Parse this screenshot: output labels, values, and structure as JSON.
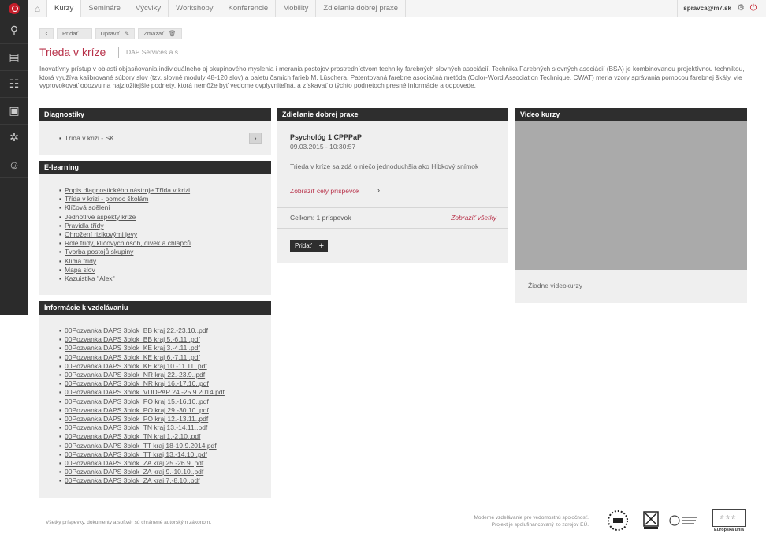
{
  "topbar": {
    "tabs": [
      "Kurzy",
      "Semináre",
      "Výcviky",
      "Workshopy",
      "Konferencie",
      "Mobility",
      "Zdieľanie dobrej praxe"
    ],
    "user": "spravca@m7.sk"
  },
  "toolbar": {
    "add": "Pridať",
    "edit": "Upraviť",
    "delete": "Zmazať"
  },
  "page": {
    "title": "Trieda v kríze",
    "org": "DAP Services a.s",
    "description": "Inovatívny prístup v oblasti objasňovania individuálneho aj skupinového myslenia i merania postojov prostredníctvom techniky farebných slovných asociácií. Technika Farebných slovných asociácií (BSA) je kombinovanou projektívnou technikou, ktorá využíva kalibrované súbory slov (tzv. slovné moduly 48-120 slov) a paletu ôsmich farieb M. Lüschera. Patentovaná farebne asociačná metóda (Color-Word Association Technique, CWAT) meria vzory správania pomocou farebnej škály, vie vyprovokovať odozvu na najzložitejšie podnety, ktorá nemôže byť vedome ovplyvniteľná, a získavať o týchto podnetoch presné informácie a odpovede."
  },
  "diagnostics": {
    "title": "Diagnostiky",
    "item": "Třída v krizi - SK"
  },
  "elearning": {
    "title": "E-learning",
    "items": [
      "Popis diagnostického nástroje Třída v krizi",
      "Třída v krizi - pomoc školám",
      "Klíčová sdělení",
      "Jednotlivé aspekty krize",
      "Pravidla třídy",
      "Ohrožení rizikovými jevy",
      "Role třídy, klíčových osob, dívek a chlapců",
      "Tvorba postojů skupiny",
      "Klima třídy",
      "Mapa slov",
      "Kazuistika \"Alex\""
    ]
  },
  "info": {
    "title": "Informácie k vzdelávaniu",
    "files": [
      "00Pozvanka DAPS 3blok_BB kraj 22.-23.10..pdf",
      "00Pozvanka DAPS 3blok_BB kraj 5.-6.11..pdf",
      "00Pozvanka DAPS 3blok_KE kraj 3.-4.11..pdf",
      "00Pozvanka DAPS 3blok_KE kraj 6.-7.11..pdf",
      "00Pozvanka DAPS 3blok_KE kraj 10.-11.11..pdf",
      "00Pozvanka DAPS 3blok_NR kraj 22.-23.9..pdf",
      "00Pozvanka DAPS 3blok_NR kraj 16.-17.10..pdf",
      "00Pozvanka DAPS 3blok_VUDPAP 24.-25.9.2014.pdf",
      "00Pozvanka DAPS 3blok_PO kraj 15.-16.10..pdf",
      "00Pozvanka DAPS 3blok_PO kraj 29.-30.10..pdf",
      "00Pozvanka DAPS 3blok_PO kraj 12.-13.11..pdf",
      "00Pozvanka DAPS 3blok_TN kraj 13.-14.11..pdf",
      "00Pozvanka DAPS 3blok_TN kraj 1.-2.10..pdf",
      "00Pozvanka DAPS 3blok_TT kraj 18-19.9.2014.pdf",
      "00Pozvanka DAPS 3blok_TT kraj 13.-14.10..pdf",
      "00Pozvanka DAPS 3blok_ZA kraj 25.-26.9..pdf",
      "00Pozvanka DAPS 3blok_ZA kraj 9.-10.10..pdf",
      "00Pozvanka DAPS 3blok_ZA kraj 7.-8.10..pdf"
    ]
  },
  "practice": {
    "title": "Zdieľanie dobrej praxe",
    "post_title": "Psychológ 1 CPPPaP",
    "post_date": "09.03.2015 - 10:30:57",
    "post_text": "Trieda v kríze sa zdá o niečo jednoduchšia ako Hĺbkový snímok",
    "show_post": "Zobraziť celý príspevok",
    "total": "Celkom: 1 príspevok",
    "show_all": "Zobraziť všetky",
    "add": "Pridať"
  },
  "video": {
    "title": "Video kurzy",
    "empty": "Žiadne videokurzy"
  },
  "footer": {
    "copyright": "Všetky príspevky, dokumenty a softvér sú chránené autorským zákonom.",
    "line1": "Moderné vzdelávanie pre vedomostnú spoločnosť.",
    "line2": "Projekt je spolufinancovaný zo zdrojov EÚ.",
    "eu_label": "Európska únia"
  }
}
